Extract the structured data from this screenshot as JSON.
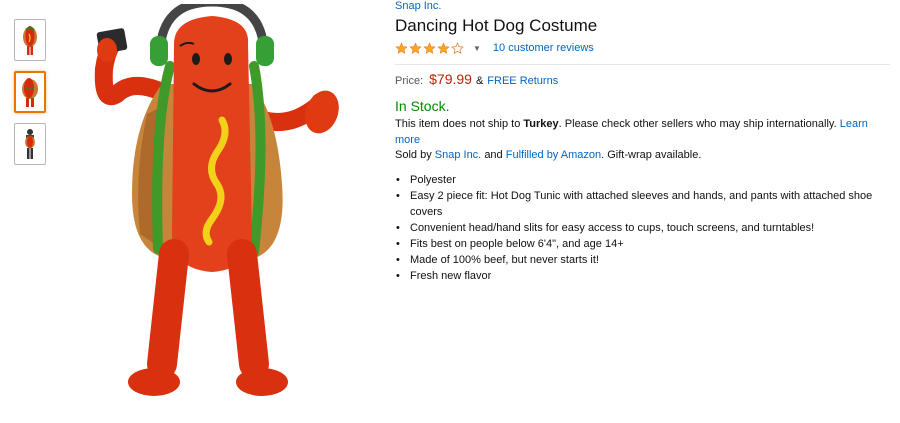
{
  "brand": "Snap Inc.",
  "title": "Dancing Hot Dog Costume",
  "rating": {
    "value": 4,
    "max": 5,
    "reviews_label": "10 customer reviews",
    "dropdown_icon": "caret-down-icon"
  },
  "price": {
    "label": "Price:",
    "amount": "$79.99",
    "ampersand": "&",
    "returns_label": "FREE Returns"
  },
  "availability": {
    "status": "In Stock.",
    "ship_prefix": "This item does not ship to",
    "ship_country": "Turkey",
    "ship_suffix": ". Please check other sellers who may ship internationally.",
    "learn_more": "Learn more"
  },
  "seller": {
    "prefix": "Sold by",
    "seller_name": "Snap Inc.",
    "and": "and",
    "fulfilled_by": "Fulfilled by Amazon",
    "suffix": ". Gift-wrap available."
  },
  "features": [
    "Polyester",
    "Easy 2 piece fit: Hot Dog Tunic with attached sleeves and hands, and pants with attached shoe covers",
    "Convenient head/hand slits for easy access to cups, touch screens, and turntables!",
    "Fits best on people below 6'4\", and age 14+",
    "Made of 100% beef, but never starts it!",
    "Fresh new flavor"
  ],
  "colors": {
    "link": "#0066c0",
    "price": "#b12704",
    "stock": "#008a00",
    "star": "#ffa41c",
    "thumb_active": "#e77600"
  }
}
